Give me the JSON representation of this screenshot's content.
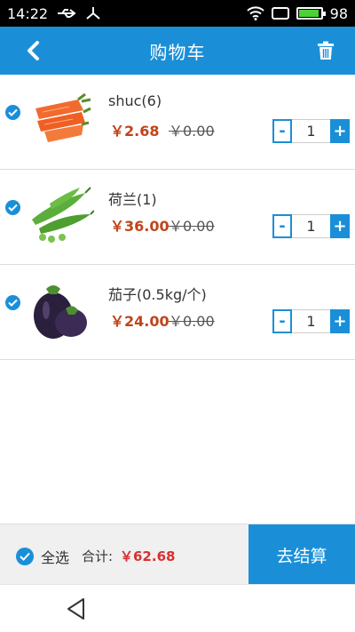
{
  "status_bar": {
    "time": "14:22",
    "battery": "98",
    "icons": [
      "usb-icon",
      "share-icon",
      "wifi-icon",
      "screen-icon",
      "battery-icon"
    ]
  },
  "app_bar": {
    "title": "购物车",
    "back_icon": "chevron-left-icon",
    "trash_icon": "trash-icon"
  },
  "items": [
    {
      "name": "shuc(6)",
      "price": "￥2.68",
      "old_price": "￥0.00",
      "qty": "1",
      "image": "carrot",
      "checked": true
    },
    {
      "name": "荷兰(1)",
      "price": "￥36.00",
      "old_price": "￥0.00",
      "qty": "1",
      "image": "peas",
      "checked": true
    },
    {
      "name": "茄子(0.5kg/个)",
      "price": "￥24.00",
      "old_price": "￥0.00",
      "qty": "1",
      "image": "eggplant",
      "checked": true
    }
  ],
  "stepper": {
    "minus": "-",
    "plus": "+"
  },
  "footer": {
    "select_all": "全选",
    "total_label": "合计:",
    "total_value": "￥62.68",
    "checkout": "去结算"
  },
  "colors": {
    "primary": "#1a8fd8",
    "price": "#c1441a",
    "total": "#d83030"
  }
}
